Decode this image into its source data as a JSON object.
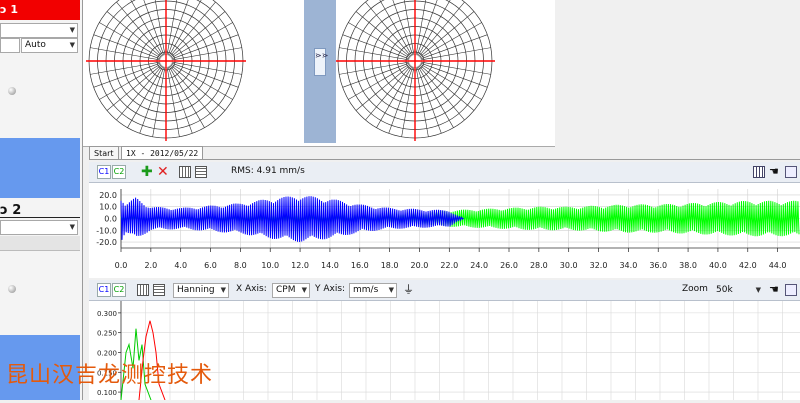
{
  "left": {
    "channel1_header": "ɔ 1",
    "auto_value": "Auto",
    "channel2_label": "ɔ 2"
  },
  "tabs": [
    {
      "label": "Start"
    },
    {
      "label": "1X - 2012/05/22"
    }
  ],
  "splitter": {
    "glyph": "⋗⋗"
  },
  "waveform_toolbar": {
    "c1": "C1",
    "c2": "C2",
    "rms": "RMS: 4.91 mm/s"
  },
  "spectrum_toolbar": {
    "c1": "C1",
    "c2": "C2",
    "window": "Hanning",
    "xaxis_label": "X Axis:",
    "xaxis_value": "CPM",
    "yaxis_label": "Y Axis:",
    "yaxis_value": "mm/s",
    "zoom_label": "Zoom",
    "zoom_value": "50k"
  },
  "watermark": "昆山汉吉龙测控技术",
  "colors": {
    "red_header": "#f20000",
    "channel_blue": "#0000ff",
    "channel_green": "#00ff00",
    "panel_blue": "#6699ee",
    "splitter": "#9db4d4"
  },
  "chart_data": [
    {
      "type": "line",
      "name": "time-waveform",
      "x_ticks": [
        "0.0",
        "2.0",
        "4.0",
        "6.0",
        "8.0",
        "10.0",
        "12.0",
        "14.0",
        "16.0",
        "18.0",
        "20.0",
        "22.0",
        "24.0",
        "26.0",
        "28.0",
        "30.0",
        "32.0",
        "34.0",
        "36.0",
        "38.0",
        "40.0",
        "42.0",
        "44.0"
      ],
      "y_ticks": [
        "20.0",
        "10.0",
        "0.0",
        "-10.0",
        "-20.0"
      ],
      "xlim": [
        0,
        45.5
      ],
      "ylim": [
        -25,
        25
      ],
      "series": [
        {
          "color": "#0000ff",
          "x": [
            0,
            0.3,
            1,
            2,
            4,
            6,
            8,
            10,
            12,
            14,
            16,
            18,
            20,
            22,
            22.5,
            23
          ],
          "amplitude": [
            20,
            12,
            18,
            10,
            9,
            11,
            13,
            17,
            20,
            17,
            12,
            9,
            8,
            7,
            3,
            0
          ]
        },
        {
          "color": "#00ff00",
          "x": [
            0,
            4,
            8,
            12,
            16,
            20,
            22,
            24,
            26,
            28,
            30,
            32,
            34,
            36,
            38,
            40,
            42,
            44,
            45.5
          ],
          "amplitude": [
            2,
            2,
            3,
            4,
            4,
            5,
            7,
            8,
            9,
            10,
            10,
            11,
            12,
            12,
            13,
            14,
            15,
            15,
            15
          ]
        }
      ]
    },
    {
      "type": "line",
      "name": "spectrum",
      "y_ticks": [
        "0.300",
        "0.250",
        "0.200",
        "0.150",
        "0.100"
      ],
      "ylim": [
        0.08,
        0.33
      ],
      "series": [
        {
          "color": "#ff0000",
          "peak": 0.28
        },
        {
          "color": "#00cc00",
          "peak": 0.26
        }
      ]
    }
  ]
}
